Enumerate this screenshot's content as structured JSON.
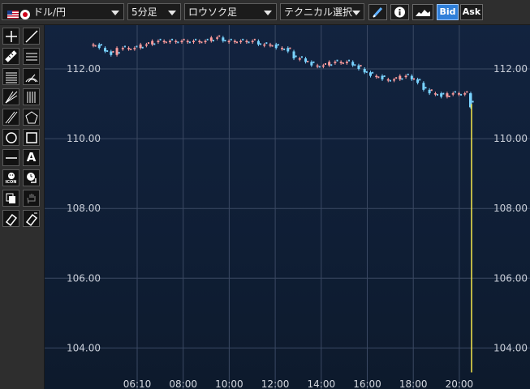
{
  "toolbar": {
    "pair_label": "ドル/円",
    "timeframe_label": "5分足",
    "chart_type_label": "ロウソク足",
    "technical_label": "テクニカル選択",
    "bid_label": "Bid",
    "ask_label": "Ask",
    "info_icon": "info-icon",
    "pen_icon": "pen-icon",
    "area_chart_icon": "area-chart-icon"
  },
  "sidebar": {
    "icon_text_a": "A",
    "icon_text_icon": "ICON"
  },
  "colors": {
    "bg": "#0f1e35",
    "grid": "#3b4963",
    "up_candle": "#ff9d9d",
    "down_candle": "#79d3ff",
    "current_price_line": "#f5e84b",
    "accent_bid": "#2f7fd9"
  },
  "chart_data": {
    "type": "line",
    "title": "",
    "xlabel": "",
    "ylabel": "",
    "x_ticks": [
      "06:10",
      "08:00",
      "10:00",
      "12:00",
      "14:00",
      "16:00",
      "18:00",
      "20:00"
    ],
    "y_ticks": [
      "112.00",
      "110.00",
      "108.00",
      "106.00",
      "104.00"
    ],
    "y_range": [
      102.9,
      113.2
    ],
    "grid": true,
    "series": [
      {
        "values": [
          112.7,
          112.6,
          112.5,
          112.4,
          112.6,
          112.6,
          112.6,
          112.6,
          112.7,
          112.7,
          112.8,
          112.8,
          112.8,
          112.8,
          112.8,
          112.8,
          112.8,
          112.8,
          112.8,
          112.8,
          112.9,
          112.9,
          112.8,
          112.8,
          112.8,
          112.8,
          112.8,
          112.8,
          112.7,
          112.7,
          112.7,
          112.6,
          112.6,
          112.5,
          112.3,
          112.3,
          112.2,
          112.1,
          112.1,
          112.1,
          112.2,
          112.2,
          112.2,
          112.2,
          112.1,
          112.0,
          111.9,
          111.8,
          111.8,
          111.7,
          111.7,
          111.7,
          111.8,
          111.8,
          111.7,
          111.6,
          111.4,
          111.3,
          111.3,
          111.2,
          111.3,
          111.3,
          111.3,
          111.3,
          110.9
        ]
      }
    ],
    "final_move": {
      "from": 110.9,
      "to": 103.3,
      "series": "current"
    }
  }
}
